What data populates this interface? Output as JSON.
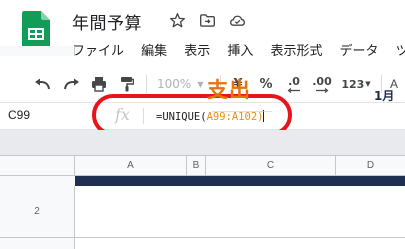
{
  "header": {
    "doc_title": "年間予算",
    "title_icons": [
      "star-icon",
      "move-to-folder-icon",
      "cloud-status-icon"
    ]
  },
  "menu": {
    "items": [
      "ファイル",
      "編集",
      "表示",
      "挿入",
      "表示形式",
      "データ",
      "ツ"
    ]
  },
  "toolbar": {
    "zoom_value": "100%",
    "currency_label": "¥",
    "percent_label": "%",
    "decrease_decimal_label": ".0",
    "increase_decimal_label": ".00",
    "more_formats_label": "123"
  },
  "formula_bar": {
    "cell_reference": "C99",
    "fx_label": "fx",
    "formula_prefix": "=UNIQUE(",
    "formula_range": "A99:A102",
    "formula_suffix": ")"
  },
  "grid": {
    "columns": [
      "A",
      "B",
      "C",
      "D"
    ],
    "rows": [
      "2"
    ],
    "cell_title": "支出",
    "cell_month": "1月"
  },
  "colors": {
    "sheets_green": "#0f9d58",
    "highlight_red": "#e8141b",
    "title_orange": "#e8710a",
    "header_navy": "#1f2f4f"
  }
}
